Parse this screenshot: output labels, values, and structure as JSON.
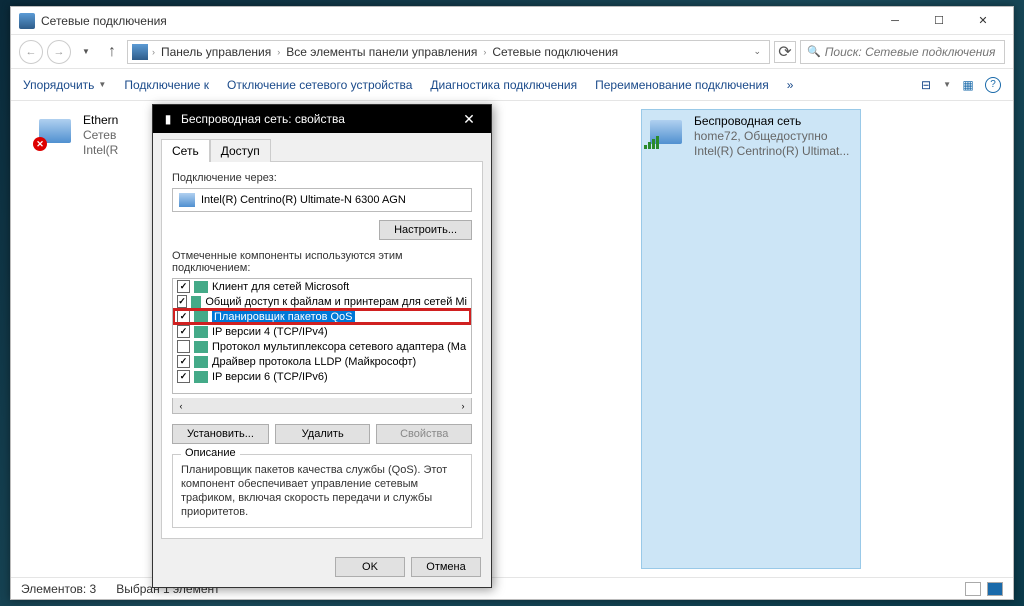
{
  "window": {
    "title": "Сетевые подключения"
  },
  "breadcrumb": {
    "items": [
      "Панель управления",
      "Все элементы панели управления",
      "Сетевые подключения"
    ]
  },
  "search": {
    "placeholder": "Поиск: Сетевые подключения"
  },
  "toolbar": {
    "organize": "Упорядочить",
    "disable": "Подключение к",
    "diagnose": "Отключение сетевого устройства",
    "diagnose2": "Диагностика подключения",
    "rename": "Переименование подключения"
  },
  "connections": [
    {
      "name": "Ethern",
      "line2": "Сетев",
      "line3": "Intel(R",
      "status": "disconnected"
    },
    {
      "name": "Беспроводная сеть",
      "line2": "home72, Общедоступно",
      "line3": "Intel(R) Centrino(R) Ultimat...",
      "status": "wifi"
    }
  ],
  "statusbar": {
    "count": "Элементов: 3",
    "selected": "Выбран 1 элемент"
  },
  "dialog": {
    "title": "Беспроводная сеть: свойства",
    "tabs": [
      "Сеть",
      "Доступ"
    ],
    "connect_label": "Подключение через:",
    "adapter": "Intel(R) Centrino(R) Ultimate-N 6300 AGN",
    "configure_btn": "Настроить...",
    "components_label": "Отмеченные компоненты используются этим подключением:",
    "components": [
      {
        "checked": true,
        "text": "Клиент для сетей Microsoft"
      },
      {
        "checked": true,
        "text": "Общий доступ к файлам и принтерам для сетей Mi"
      },
      {
        "checked": true,
        "text": "Планировщик пакетов QoS",
        "selected": true,
        "highlighted": true
      },
      {
        "checked": true,
        "text": "IP версии 4 (TCP/IPv4)"
      },
      {
        "checked": false,
        "text": "Протокол мультиплексора сетевого адаптера (Ма"
      },
      {
        "checked": true,
        "text": "Драйвер протокола LLDP (Майкрософт)"
      },
      {
        "checked": true,
        "text": "IP версии 6 (TCP/IPv6)"
      }
    ],
    "install_btn": "Установить...",
    "remove_btn": "Удалить",
    "properties_btn": "Свойства",
    "desc_title": "Описание",
    "desc_text": "Планировщик пакетов качества службы (QoS). Этот компонент обеспечивает управление сетевым трафиком, включая скорость передачи и службы приоритетов.",
    "ok": "OK",
    "cancel": "Отмена"
  }
}
